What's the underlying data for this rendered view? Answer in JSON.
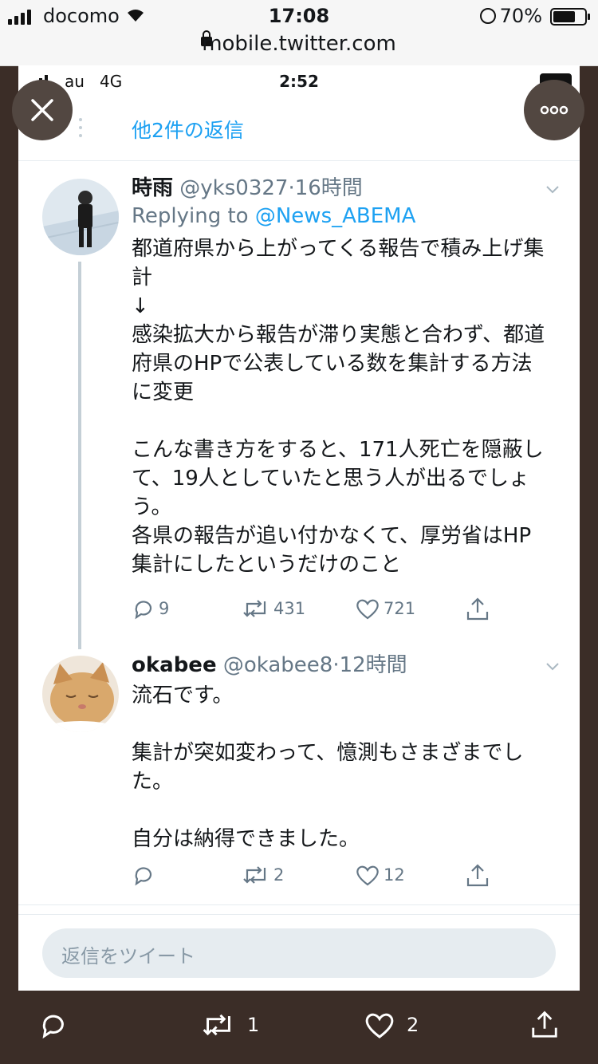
{
  "outer_status": {
    "carrier": "docomo",
    "time": "17:08",
    "battery_percent": "70%",
    "battery_level": 0.7,
    "url": "mobile.twitter.com"
  },
  "inner_status": {
    "carrier": "au",
    "network": "4G",
    "time": "2:52"
  },
  "thread": {
    "more_replies_label": "他2件の返信"
  },
  "tweets": [
    {
      "name": "時雨",
      "handle": "@yks0327",
      "time": "16時間",
      "reply_prefix": "Replying to ",
      "reply_mention": "@News_ABEMA",
      "text": "都道府県から上がってくる報告で積み上げ集\n計\n↓\n感染拡大から報告が滞り実態と合わず、都道\n府県のHPで公表している数を集計する方法\nに変更\n\nこんな書き方をすると、171人死亡を隠蔽し\nて、19人としていたと思う人が出るでしょ\nう。\n各県の報告が追い付かなくて、厚労省はHP\n集計にしたというだけのこと",
      "replies": "9",
      "retweets": "431",
      "likes": "721"
    },
    {
      "name": "okabee",
      "handle": "@okabee8",
      "time": "12時間",
      "text": "流石です。\n\n集計が突如変わって、憶測もさまざまでし\nた。\n\n自分は納得できました。",
      "replies": "",
      "retweets": "2",
      "likes": "12"
    }
  ],
  "reply_box": {
    "placeholder": "返信をツイート"
  },
  "bottom_bar": {
    "retweet_count": "1",
    "like_count": "2"
  },
  "colors": {
    "link": "#1da1f2",
    "muted": "#657786",
    "backdrop": "#3b2d27"
  }
}
